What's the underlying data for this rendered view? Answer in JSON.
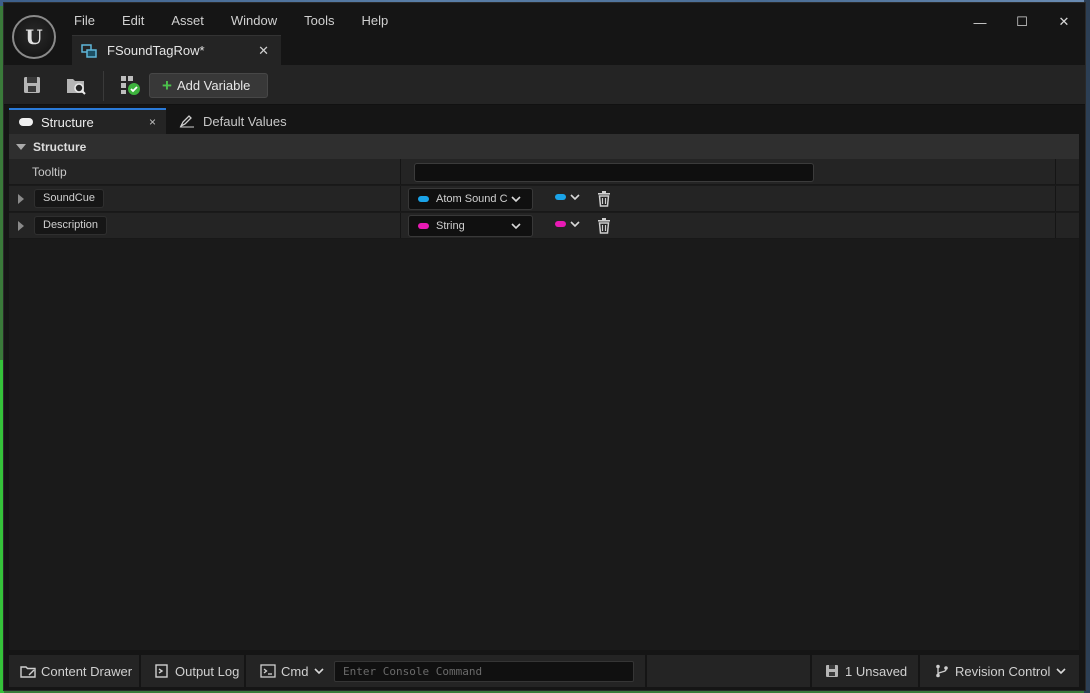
{
  "window": {
    "menu": [
      "File",
      "Edit",
      "Asset",
      "Window",
      "Tools",
      "Help"
    ],
    "logo_text": "U",
    "document_tab": "FSoundTagRow*",
    "controls": {
      "minimize": "—",
      "maximize": "☐",
      "close": "✕"
    }
  },
  "toolbar": {
    "add_variable": "Add Variable",
    "add_icon": "+"
  },
  "panel_tabs": {
    "structure": "Structure",
    "structure_close": "×",
    "default_values": "Default Values"
  },
  "details": {
    "category": "Structure",
    "tooltip_label": "Tooltip",
    "tooltip_value": "",
    "variables": [
      {
        "name": "SoundCue",
        "type": "Atom Sound C",
        "color": "#1aa3e8"
      },
      {
        "name": "Description",
        "type": "String",
        "color": "#e81ab4"
      }
    ]
  },
  "statusbar": {
    "content_drawer": "Content Drawer",
    "output_log": "Output Log",
    "cmd": "Cmd",
    "console_placeholder": "Enter Console Command",
    "unsaved": "1 Unsaved",
    "revision_control": "Revision Control"
  },
  "colors": {
    "accent_blue": "#2a7ad8",
    "add_green": "#4cc24c",
    "object_pin": "#1aa3e8",
    "string_pin": "#e81ab4"
  }
}
